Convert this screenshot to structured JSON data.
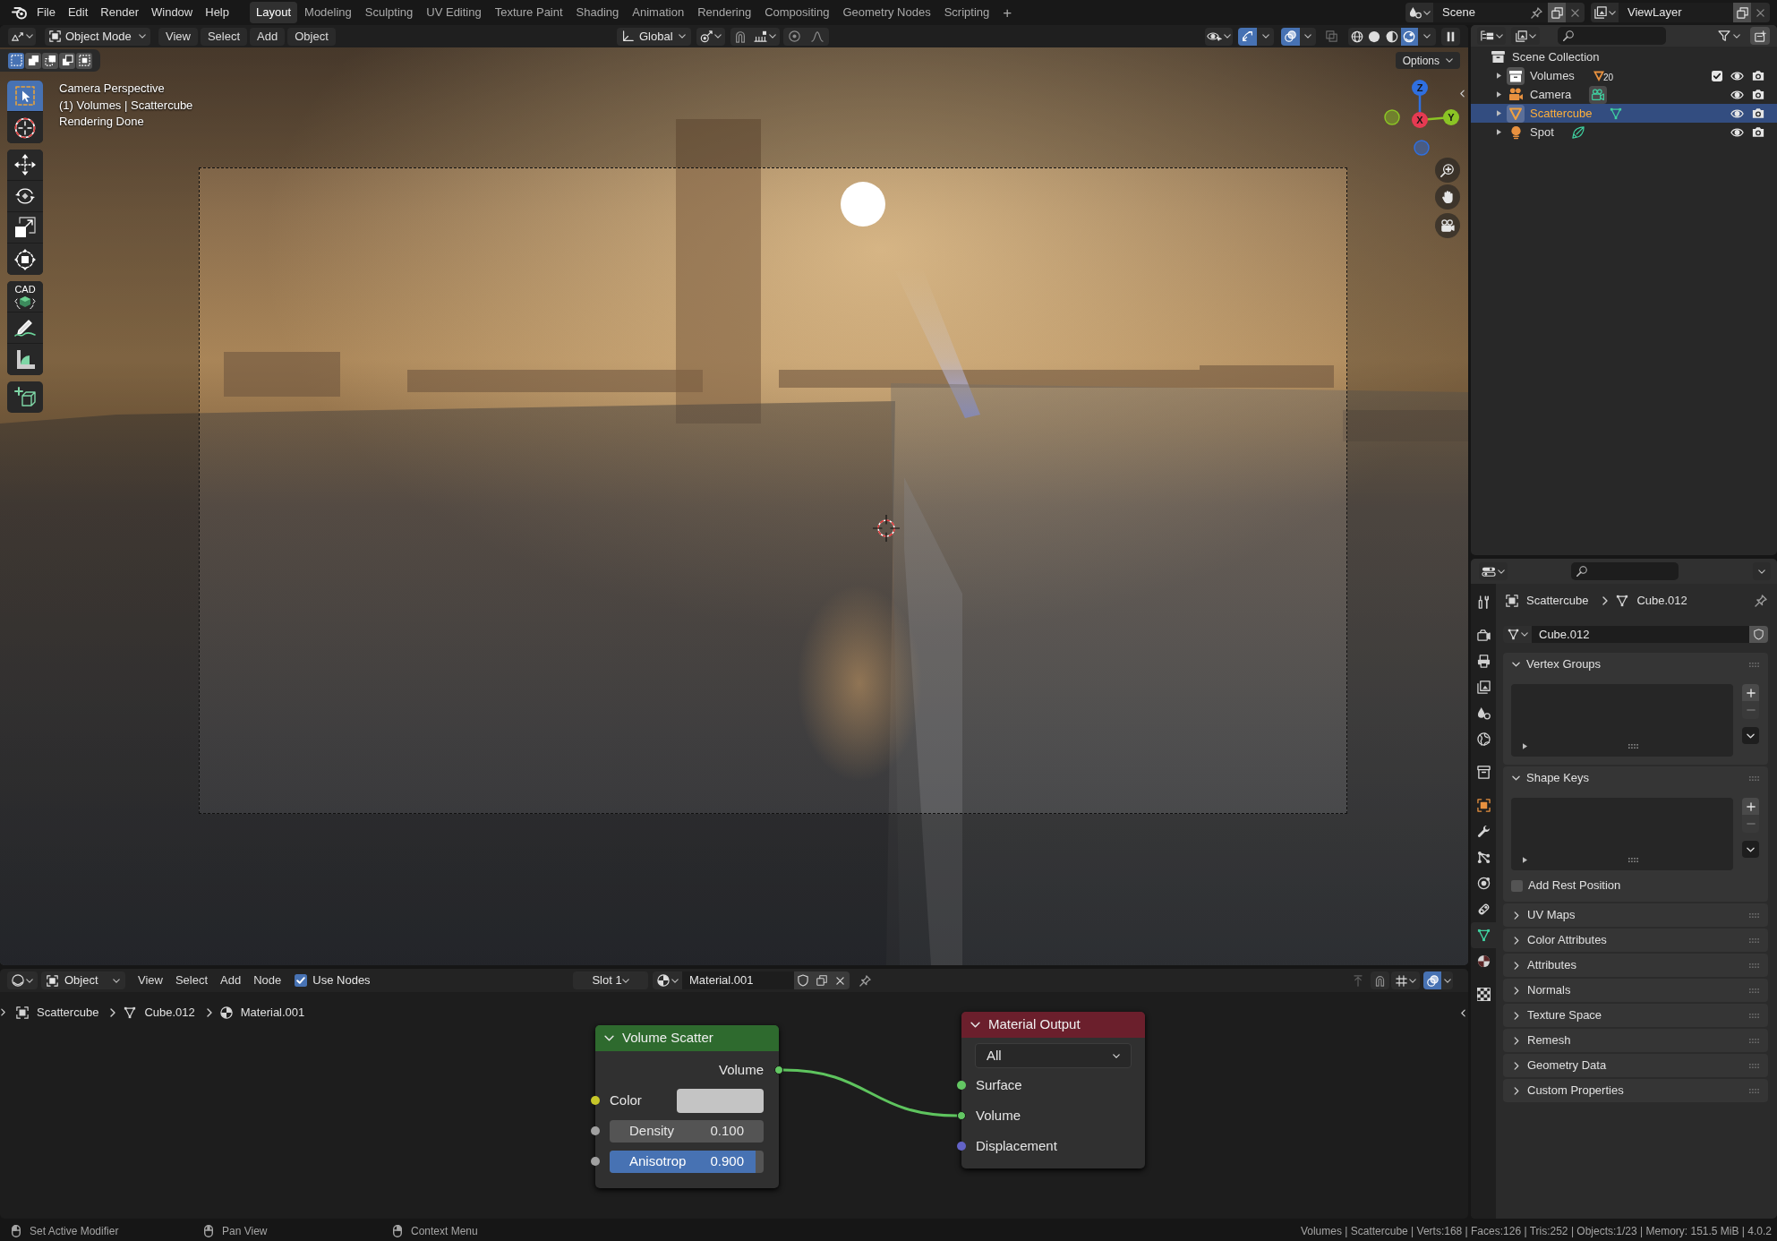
{
  "top_bar": {
    "menus": [
      "File",
      "Edit",
      "Render",
      "Window",
      "Help"
    ],
    "workspaces": [
      {
        "label": "Layout",
        "selected": true
      },
      {
        "label": "Modeling",
        "selected": false
      },
      {
        "label": "Sculpting",
        "selected": false
      },
      {
        "label": "UV Editing",
        "selected": false
      },
      {
        "label": "Texture Paint",
        "selected": false
      },
      {
        "label": "Shading",
        "selected": false
      },
      {
        "label": "Animation",
        "selected": false
      },
      {
        "label": "Rendering",
        "selected": false
      },
      {
        "label": "Compositing",
        "selected": false
      },
      {
        "label": "Geometry Nodes",
        "selected": false
      },
      {
        "label": "Scripting",
        "selected": false
      }
    ],
    "add_workspace": "+",
    "scene": "Scene",
    "view_layer": "ViewLayer"
  },
  "viewport": {
    "header": {
      "mode": "Object Mode",
      "menus": [
        "View",
        "Select",
        "Add",
        "Object"
      ],
      "orientation": "Global",
      "shading": [
        {
          "kind": "wireframe",
          "selected": false
        },
        {
          "kind": "solid",
          "selected": false
        },
        {
          "kind": "material",
          "selected": false
        },
        {
          "kind": "rendered",
          "selected": true
        }
      ]
    },
    "select_modes": [
      {
        "kind": "set",
        "selected": true
      },
      {
        "kind": "extend",
        "selected": false
      },
      {
        "kind": "subtract",
        "selected": false
      },
      {
        "kind": "invert",
        "selected": false
      },
      {
        "kind": "intersect",
        "selected": false
      }
    ],
    "tool_groups": [
      [
        {
          "kind": "select_box",
          "selected": true
        },
        {
          "kind": "cursor",
          "selected": false
        }
      ],
      [
        {
          "kind": "move",
          "selected": false
        },
        {
          "kind": "rotate",
          "selected": false
        },
        {
          "kind": "scale",
          "selected": false
        },
        {
          "kind": "transform",
          "selected": false
        }
      ],
      [
        {
          "kind": "cad",
          "label": "CAD",
          "selected": false
        },
        {
          "kind": "annotate",
          "selected": false
        },
        {
          "kind": "measure",
          "selected": false
        }
      ],
      [
        {
          "kind": "add_cube",
          "selected": false
        }
      ]
    ],
    "info": [
      "Camera Perspective",
      "(1) Volumes | Scattercube",
      "Rendering Done"
    ],
    "options": "Options",
    "gizmo_axes": [
      {
        "label": "Z",
        "color": "#2f6fe0"
      },
      {
        "label": "Y",
        "color": "#8bc425"
      },
      {
        "label": "X",
        "color": "#e63a52"
      }
    ]
  },
  "outliner": {
    "root": {
      "name": "Scene Collection",
      "children": [
        {
          "kind": "collection",
          "name": "Volumes",
          "count": "20",
          "checked": true,
          "expanded": false,
          "selected": false
        },
        {
          "kind": "camera",
          "name": "Camera",
          "expanded": false,
          "selected": false
        },
        {
          "kind": "mesh",
          "name": "Scattercube",
          "expanded": false,
          "selected": true
        },
        {
          "kind": "light",
          "name": "Spot",
          "expanded": false,
          "selected": false
        }
      ]
    }
  },
  "properties": {
    "tab_groups": [
      [
        {
          "kind": "tool",
          "selected": false
        }
      ],
      [
        {
          "kind": "render",
          "selected": false
        },
        {
          "kind": "output",
          "selected": false
        },
        {
          "kind": "view_layer",
          "selected": false
        },
        {
          "kind": "scene",
          "selected": false
        },
        {
          "kind": "world",
          "selected": false
        }
      ],
      [
        {
          "kind": "collection",
          "selected": false
        }
      ],
      [
        {
          "kind": "object",
          "selected": false
        },
        {
          "kind": "modifiers",
          "selected": false
        },
        {
          "kind": "particles",
          "selected": false
        },
        {
          "kind": "physics",
          "selected": false
        },
        {
          "kind": "constraints",
          "selected": false
        },
        {
          "kind": "data",
          "selected": true
        },
        {
          "kind": "material",
          "selected": false
        }
      ],
      [
        {
          "kind": "texture",
          "selected": false
        }
      ]
    ],
    "breadcrumb": [
      {
        "kind": "object",
        "label": "Scattercube"
      },
      {
        "kind": "mesh",
        "label": "Cube.012"
      }
    ],
    "datablock": "Cube.012",
    "panels": [
      {
        "title": "Vertex Groups",
        "expanded": true
      },
      {
        "title": "Shape Keys",
        "expanded": true,
        "option": {
          "label": "Add Rest Position",
          "checked": false
        }
      },
      {
        "title": "UV Maps",
        "expanded": false
      },
      {
        "title": "Color Attributes",
        "expanded": false
      },
      {
        "title": "Attributes",
        "expanded": false
      },
      {
        "title": "Normals",
        "expanded": false
      },
      {
        "title": "Texture Space",
        "expanded": false
      },
      {
        "title": "Remesh",
        "expanded": false
      },
      {
        "title": "Geometry Data",
        "expanded": false
      },
      {
        "title": "Custom Properties",
        "expanded": false
      }
    ]
  },
  "node_editor": {
    "header": {
      "mode": "Object",
      "menus": [
        "View",
        "Select",
        "Add",
        "Node"
      ],
      "use_nodes": {
        "label": "Use Nodes",
        "checked": true
      },
      "slot": "Slot 1",
      "material": "Material.001"
    },
    "breadcrumb": [
      {
        "kind": "object",
        "label": "Scattercube"
      },
      {
        "kind": "mesh",
        "label": "Cube.012"
      },
      {
        "kind": "material",
        "label": "Material.001"
      }
    ],
    "nodes": [
      {
        "title": "Volume Scatter",
        "color": "#2e6a2e",
        "outputs": [
          {
            "label": "Volume",
            "color": "#63c763",
            "linked": true
          }
        ],
        "inputs": [
          {
            "kind": "color",
            "label": "Color",
            "color": "#c7c729",
            "swatch": {
              "color": "#c4c4c4"
            },
            "linked": false
          },
          {
            "kind": "value",
            "label": "Density",
            "value": "0.100",
            "color": "#a1a1a1",
            "linked": false
          },
          {
            "kind": "slider",
            "label": "Anisotrop",
            "value": "0.900",
            "level": 0.95,
            "color": "#a1a1a1",
            "linked": false
          }
        ]
      },
      {
        "title": "Material Output",
        "color": "#6b1f2c",
        "target": "All",
        "inputs": [
          {
            "kind": "socket",
            "label": "Surface",
            "color": "#63c763",
            "linked": false
          },
          {
            "kind": "socket",
            "label": "Volume",
            "color": "#63c763",
            "linked": true
          },
          {
            "kind": "socket",
            "label": "Displacement",
            "color": "#6363c7",
            "linked": false
          }
        ]
      }
    ]
  },
  "status_bar": {
    "hints": [
      {
        "kind": "left_click",
        "label": "Set Active Modifier"
      },
      {
        "kind": "middle_click",
        "label": "Pan View"
      },
      {
        "kind": "right_click",
        "label": "Context Menu"
      }
    ],
    "stats": "Volumes | Scattercube | Verts:168 | Faces:126 | Tris:252 | Objects:1/23 | Memory: 151.5 MiB | 4.0.2"
  }
}
